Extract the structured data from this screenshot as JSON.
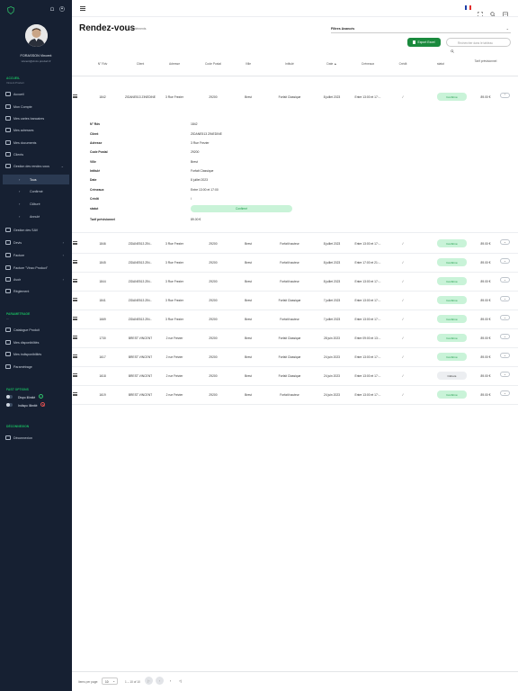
{
  "colors": {
    "sidebar_bg": "#162032",
    "accent_green": "#1aa74c",
    "badge_confirmed_bg": "#c9f3d8",
    "badge_confirmed_text": "#1c9b48",
    "badge_closed_bg": "#eceef1",
    "badge_closed_text": "#333333"
  },
  "user": {
    "name": "FORASSON Vincent",
    "email": "vincent@vinzo.product.fr"
  },
  "sidebar": {
    "section_accueil": "ACCUEIL",
    "section_accueil_sub": "Vincent Product",
    "items": [
      {
        "label": "Accueil",
        "icon": "home-icon"
      },
      {
        "label": "Mon Compte",
        "icon": "user-icon"
      },
      {
        "label": "Mes cartes bancaires",
        "icon": "card-icon"
      },
      {
        "label": "Mes adresses",
        "icon": "address-icon"
      },
      {
        "label": "Mes documents",
        "icon": "document-icon"
      },
      {
        "label": "Clients",
        "icon": "clients-icon"
      },
      {
        "label": "Gestion des rendez-vous",
        "icon": "calendar-icon"
      }
    ],
    "subitems": [
      "Tous",
      "Confirmé",
      "Clôturé",
      "Annulé"
    ],
    "items2": [
      {
        "label": "Gestion des SAV",
        "icon": "wrench-icon"
      },
      {
        "label": "Devis",
        "icon": "quote-icon"
      },
      {
        "label": "Facture",
        "icon": "invoice-icon"
      },
      {
        "label": "Facture \"Vinzo Product\"",
        "icon": "invoice-icon"
      },
      {
        "label": "Avoir",
        "icon": "credit-icon"
      },
      {
        "label": "Règlement",
        "icon": "payment-icon"
      }
    ],
    "section_param": "PARAMETRAGE",
    "section_param_sub": "—",
    "items3": [
      {
        "label": "Catalogue Produit",
        "icon": "catalog-icon"
      },
      {
        "label": "Mes disponibilités",
        "icon": "availability-icon"
      },
      {
        "label": "Mes indisponibilités",
        "icon": "unavailability-icon"
      },
      {
        "label": "Paramétrage",
        "icon": "settings-icon"
      }
    ],
    "section_options": "FAST OPTIONS",
    "toggle1": "Dispo Illimité",
    "toggle2": "Indispo Illimité",
    "section_logout": "DÉCONNEXION",
    "logout": "Déconnexion"
  },
  "page": {
    "title": "Rendez-vous",
    "count": "25 éléments",
    "filters": "Filtres Avancés",
    "export": "Export Excel",
    "search_placeholder": "Rechercher dans le tableau"
  },
  "columns": [
    "N° Rdv",
    "Client",
    "Adresse",
    "Code Postal",
    "Ville",
    "Intitulé",
    "Date ▲",
    "Créneaux",
    "Crédit",
    "statut",
    "Tarif prévisionnel"
  ],
  "first_row": {
    "id": "1842",
    "client": "ZIDANE513 ZINEDINE",
    "adresse": "3 Rue Frezier",
    "cp": "29200",
    "ville": "Brest",
    "intitule": "Forfait Classique",
    "date": "8 juillet 2023",
    "creneau": "Entre 13:00 et 17:...",
    "credit": "/",
    "statut": "Confirmé",
    "tarif": "89.00 €"
  },
  "detail": [
    {
      "label": "N° Rdv",
      "value": "1842"
    },
    {
      "label": "Client",
      "value": "ZIDANE513 ZINEDINE"
    },
    {
      "label": "Adresse",
      "value": "3 Rue Frezier"
    },
    {
      "label": "Code Postal",
      "value": "29200"
    },
    {
      "label": "Ville",
      "value": "Brest"
    },
    {
      "label": "Intitulé",
      "value": "Forfait Classique"
    },
    {
      "label": "Date",
      "value": "8 juillet 2023"
    },
    {
      "label": "Créneaux",
      "value": "Entre 13:00 et 17:00"
    },
    {
      "label": "Crédit",
      "value": "/"
    },
    {
      "label": "statut",
      "value": "Confirmé"
    },
    {
      "label": "Tarif prévisionnel",
      "value": "89.00 €"
    }
  ],
  "rows": [
    {
      "id": "1846",
      "client": "ZIDANE513 ZIN...",
      "adresse": "3 Rue Frezier",
      "cp": "29200",
      "ville": "Brest",
      "intitule": "Forfait hauteur",
      "date": "8 juillet 2023",
      "creneau": "Entre 13:00 et 17:...",
      "credit": "/",
      "statut": "Confirmé",
      "tarif": "89.00 €"
    },
    {
      "id": "1845",
      "client": "ZIDANE513 ZIN...",
      "adresse": "3 Rue Frezier",
      "cp": "29200",
      "ville": "Brest",
      "intitule": "Forfait hauteur",
      "date": "8 juillet 2023",
      "creneau": "Entre 17:00 et 21:...",
      "credit": "/",
      "statut": "Confirmé",
      "tarif": "89.00 €"
    },
    {
      "id": "1844",
      "client": "ZIDANE513 ZIN...",
      "adresse": "3 Rue Frezier",
      "cp": "29200",
      "ville": "Brest",
      "intitule": "Forfait hauteur",
      "date": "8 juillet 2023",
      "creneau": "Entre 13:00 et 17:...",
      "credit": "/",
      "statut": "Confirmé",
      "tarif": "89.00 €"
    },
    {
      "id": "1841",
      "client": "ZIDANE513 ZIN...",
      "adresse": "3 Rue Frezier",
      "cp": "29200",
      "ville": "Brest",
      "intitule": "Forfait Classique",
      "date": "7 juillet 2023",
      "creneau": "Entre 13:00 et 17:...",
      "credit": "/",
      "statut": "Confirmé",
      "tarif": "89.00 €"
    },
    {
      "id": "1669",
      "client": "ZIDANE513 ZIN...",
      "adresse": "3 Rue Frezier",
      "cp": "29200",
      "ville": "Brest",
      "intitule": "Forfait hauteur",
      "date": "7 juillet 2023",
      "creneau": "Entre 13:00 et 17:...",
      "credit": "/",
      "statut": "Confirmé",
      "tarif": "89.00 €"
    },
    {
      "id": "1730",
      "client": "BREST VINCENT",
      "adresse": "2 rue Frézier",
      "cp": "29200",
      "ville": "Brest",
      "intitule": "Forfait Classique",
      "date": "28 juin 2023",
      "creneau": "Entre 09:00 et 13:...",
      "credit": "/",
      "statut": "Confirmé",
      "tarif": "89.00 €"
    },
    {
      "id": "1617",
      "client": "BREST VINCENT",
      "adresse": "2 rue Frézier",
      "cp": "29200",
      "ville": "Brest",
      "intitule": "Forfait Classique",
      "date": "24 juin 2023",
      "creneau": "Entre 13:00 et 17:...",
      "credit": "/",
      "statut": "Confirmé",
      "tarif": "89.00 €"
    },
    {
      "id": "1618",
      "client": "BREST VINCENT",
      "adresse": "2 rue Frézier",
      "cp": "29200",
      "ville": "Brest",
      "intitule": "Forfait Classique",
      "date": "24 juin 2023",
      "creneau": "Entre 13:00 et 17:...",
      "credit": "/",
      "statut": "Clôturé",
      "tarif": "89.00 €"
    },
    {
      "id": "1619",
      "client": "BREST VINCENT",
      "adresse": "2 rue Frézier",
      "cp": "29200",
      "ville": "Brest",
      "intitule": "Forfait hauteur",
      "date": "24 juin 2023",
      "creneau": "Entre 13:00 et 17:...",
      "credit": "/",
      "statut": "Confirmé",
      "tarif": "89.00 €"
    }
  ],
  "pagination": {
    "items_per_page": "Items per page:",
    "per_page_value": "10",
    "range": "1 – 10 of 10"
  }
}
